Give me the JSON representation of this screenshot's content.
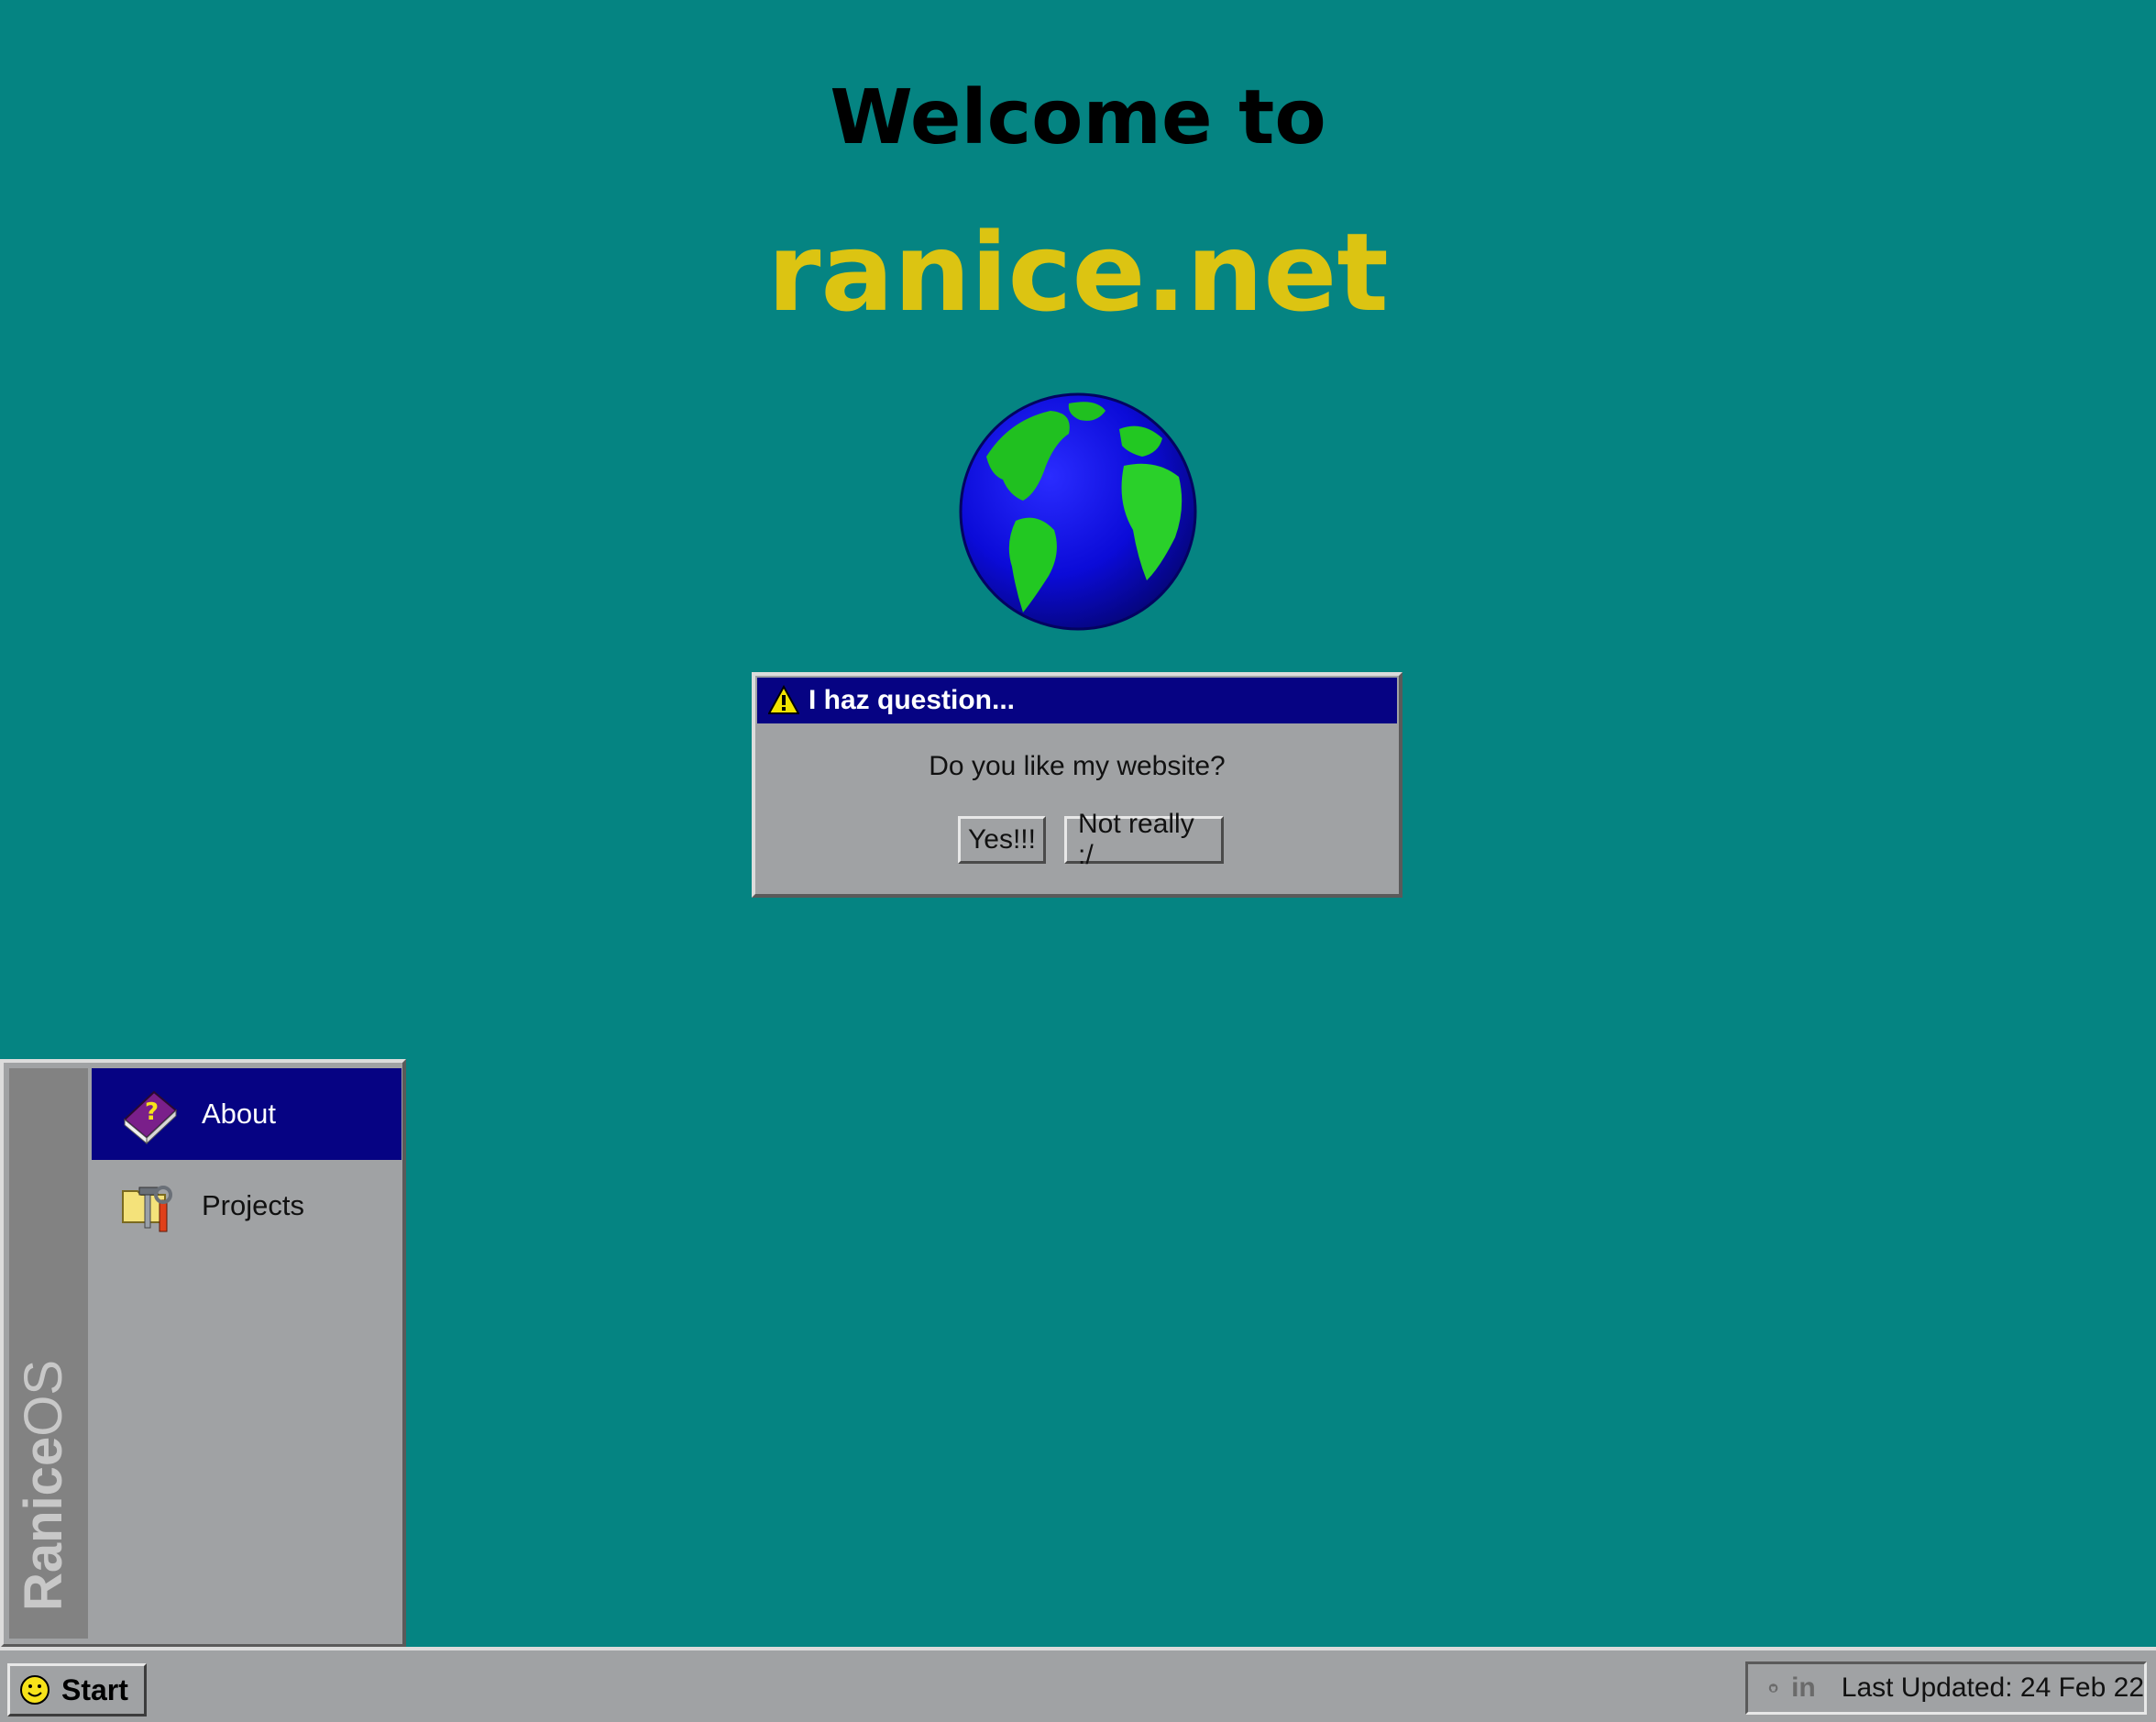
{
  "hero": {
    "welcome": "Welcome to",
    "site_name": "ranice.net",
    "globe_icon": "globe-icon"
  },
  "dialog": {
    "title": "I haz question...",
    "title_icon": "warning-icon",
    "message": "Do you like my website?",
    "yes_label": "Yes!!!",
    "no_label": "Not really :/"
  },
  "start_menu": {
    "brand_bold": "Ranice",
    "brand_light": "OS",
    "items": [
      {
        "label": "About",
        "icon": "help-book-icon",
        "selected": true
      },
      {
        "label": "Projects",
        "icon": "folder-tools-icon",
        "selected": false
      }
    ]
  },
  "taskbar": {
    "start_label": "Start",
    "start_icon": "smiley-icon",
    "tray": {
      "github_icon": "github-icon",
      "linkedin_label": "in",
      "last_updated": "Last Updated: 24 Feb 22"
    }
  },
  "colors": {
    "desktop": "#058482",
    "titlebar": "#060383",
    "site_name": "#dcc412",
    "chrome": "#a0a2a4"
  }
}
